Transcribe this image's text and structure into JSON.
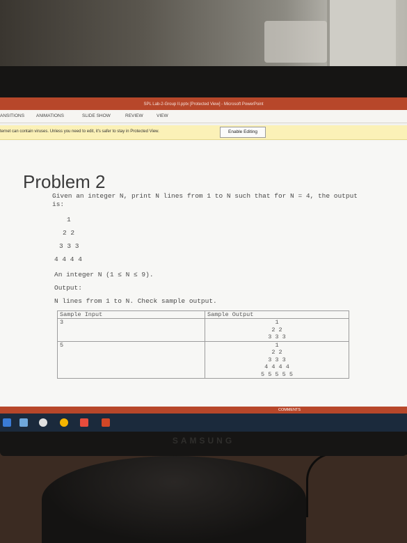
{
  "window": {
    "title": "SPL Lab-2-Group II.pptx [Protected View] - Microsoft PowerPoint"
  },
  "ribbon": {
    "tabs": [
      "ANSITIONS",
      "ANIMATIONS",
      "SLIDE SHOW",
      "REVIEW",
      "VIEW"
    ]
  },
  "protected_view": {
    "message": "ternet can contain viruses. Unless you need to edit, it's safer to stay in Protected View.",
    "button": "Enable Editing"
  },
  "slide": {
    "title": "Problem 2",
    "intro_line1": "Given an integer N, print N lines from 1 to N such that for N = 4, the output",
    "intro_line2": "is:",
    "example": [
      "1",
      "2 2",
      "3 3 3",
      "4 4 4 4"
    ],
    "input_desc": "An integer N (1 ≤ N ≤ 9).",
    "output_label": "Output:",
    "output_desc": "N lines from 1 to N. Check sample output.",
    "table": {
      "headers": [
        "Sample Input",
        "Sample Output"
      ],
      "rows": [
        {
          "input": "3",
          "output": [
            "1",
            "2 2",
            "3 3 3"
          ]
        },
        {
          "input": "5",
          "output": [
            "1",
            "2 2",
            "3 3 3",
            "4 4 4 4",
            "5 5 5 5 5"
          ]
        }
      ]
    }
  },
  "statusbar": {
    "comments": "COMMENTS"
  },
  "monitor": {
    "brand": "SAMSUNG"
  }
}
